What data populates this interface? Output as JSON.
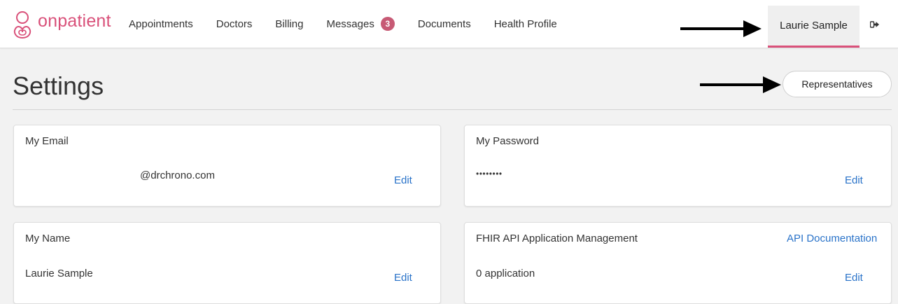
{
  "nav": {
    "logo_text": "onpatient",
    "items": [
      {
        "label": "Appointments"
      },
      {
        "label": "Doctors"
      },
      {
        "label": "Billing"
      },
      {
        "label": "Messages",
        "badge": "3"
      },
      {
        "label": "Documents"
      },
      {
        "label": "Health Profile"
      }
    ],
    "user_name": "Laurie Sample",
    "logout_icon": "sign-out-icon"
  },
  "page": {
    "title": "Settings",
    "representatives_label": "Representatives"
  },
  "cards": {
    "email": {
      "title": "My Email",
      "value": "@drchrono.com",
      "action": "Edit"
    },
    "password": {
      "title": "My Password",
      "value": "••••••••",
      "action": "Edit"
    },
    "name": {
      "title": "My Name",
      "value": "Laurie Sample",
      "action": "Edit"
    },
    "fhir": {
      "title": "FHIR API Application Management",
      "doc_link": "API Documentation",
      "value": "0 application",
      "action": "Edit"
    }
  },
  "colors": {
    "brand": "#d9517a",
    "badge": "#c75a75",
    "link": "#2a73c9",
    "background": "#f2f2f2"
  }
}
